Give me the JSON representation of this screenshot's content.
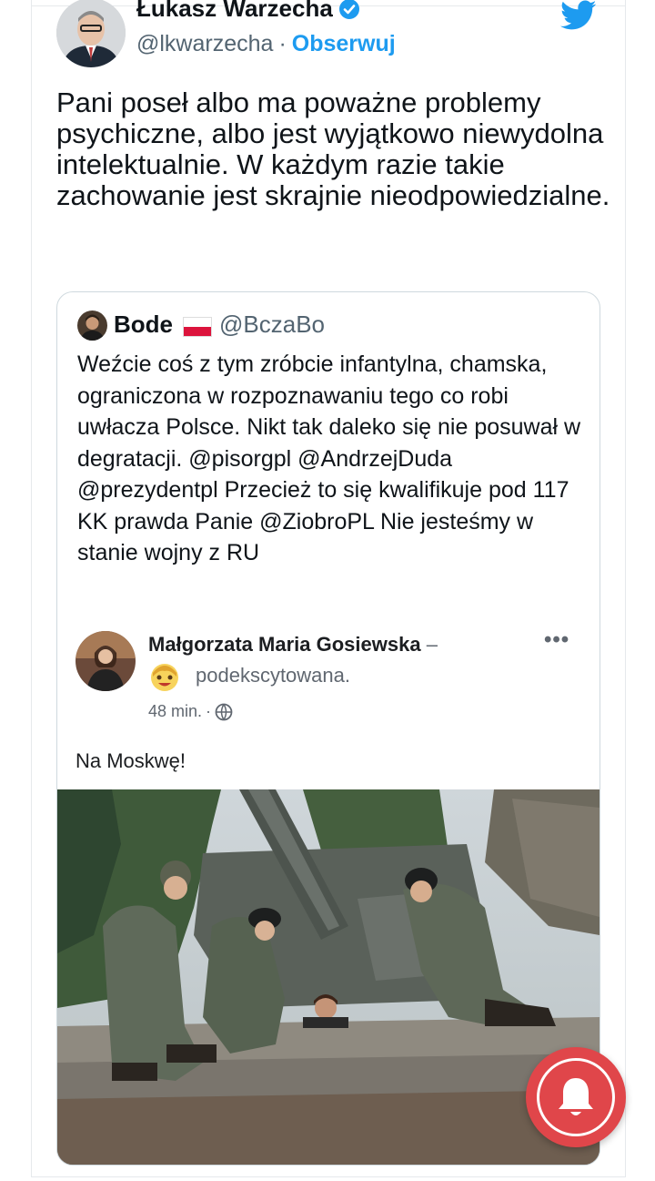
{
  "tweet": {
    "author_name": "Łukasz Warzecha",
    "author_handle": "@lkwarzecha",
    "separator": "·",
    "follow_label": "Obserwuj",
    "text": "Pani poseł albo ma poważne problemy psychiczne, albo jest wyjątkowo niewydolna intelektualnie. W każdym razie takie zachowanie jest skrajnie nieodpowiedzialne."
  },
  "quote": {
    "author_name": "Bode",
    "author_handle": "@BczaBo",
    "text": "Weźcie coś z tym zróbcie infantylna, chamska, ograniczona w rozpoznawaniu tego co robi uwłacza  Polsce. Nikt tak daleko się nie posuwał w degratacji. @pisorgpl @AndrzejDuda @prezydentpl Przecież to się kwalifikuje pod 117 KK prawda Panie @ZiobroPL Nie jesteśmy w stanie wojny z RU"
  },
  "fb_post": {
    "author_name": "Małgorzata Maria Gosiewska",
    "dash": "–",
    "more": "•••",
    "feeling": "podekscytowana.",
    "time": "48 min.",
    "time_sep": "·",
    "text": "Na Moskwę!"
  },
  "icons": {
    "verified": "verified-badge-icon",
    "twitter": "twitter-bird-icon",
    "flag": "poland-flag-icon",
    "globe": "globe-icon",
    "emoji": "excited-emoji-icon",
    "bell": "bell-icon"
  },
  "colors": {
    "twitter_blue": "#1d9bf0",
    "bell_button": "#e0464a"
  }
}
